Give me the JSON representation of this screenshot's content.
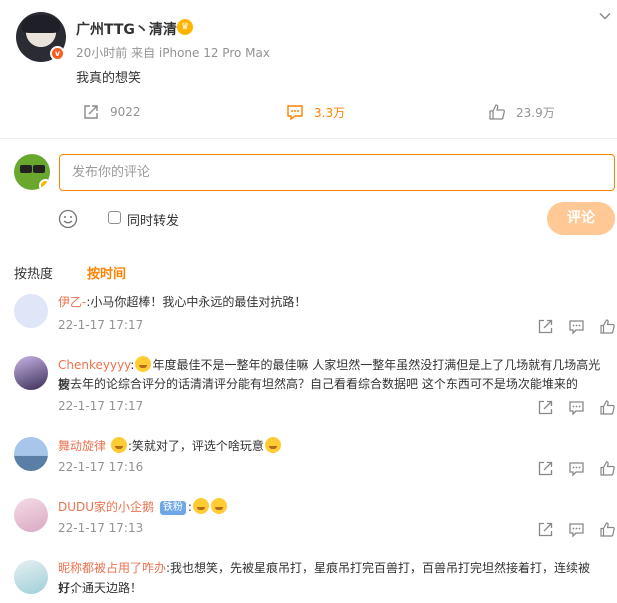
{
  "post": {
    "author_name": "广州TTG丶清清",
    "meta": "20小时前  来自 iPhone 12 Pro Max",
    "text": "我真的想笑",
    "actions": {
      "repost_count": "9022",
      "comment_count": "3.3万",
      "like_count": "23.9万"
    }
  },
  "composer": {
    "placeholder": "发布你的评论",
    "repost_label": "同时转发",
    "submit_label": "评论"
  },
  "sort": {
    "by_hot": "按热度",
    "by_time": "按时间"
  },
  "comments": [
    {
      "user": "伊乙-",
      "text": ":小马你超棒！我心中永远的最佳对抗路！",
      "time": "22-1-17 17:17"
    },
    {
      "user": "Chenkeyyyy",
      "text_line1": "年度最佳不是一整年的最佳嘛 人家坦然一整年虽然没打满但是上了几场就有几场高光 要",
      "text_line2": "按去年的论综合评分的话清清评分能有坦然高？自己看看综合数据吧 这个东西可不是场次能堆来的",
      "time": "22-1-17 17:17"
    },
    {
      "user": "舞动旋律",
      "text": "笑就对了，评选个啥玩意",
      "time": "22-1-17 17:16"
    },
    {
      "user": "DUDU家的小企鹅",
      "badge": "铁粉",
      "time": "22-1-17 17:13"
    },
    {
      "user": "昵称都被占用了咋办",
      "text_line1": ":我也想笑，先被星痕吊打，星痕吊打完百兽打，百兽吊打完坦然接着打，连续被打，",
      "text_line2": "好个通天边路！"
    }
  ],
  "colors": {
    "accent": "#ff8200",
    "username": "#eb7350",
    "muted": "#939393",
    "submit_disabled": "#ffc895"
  }
}
